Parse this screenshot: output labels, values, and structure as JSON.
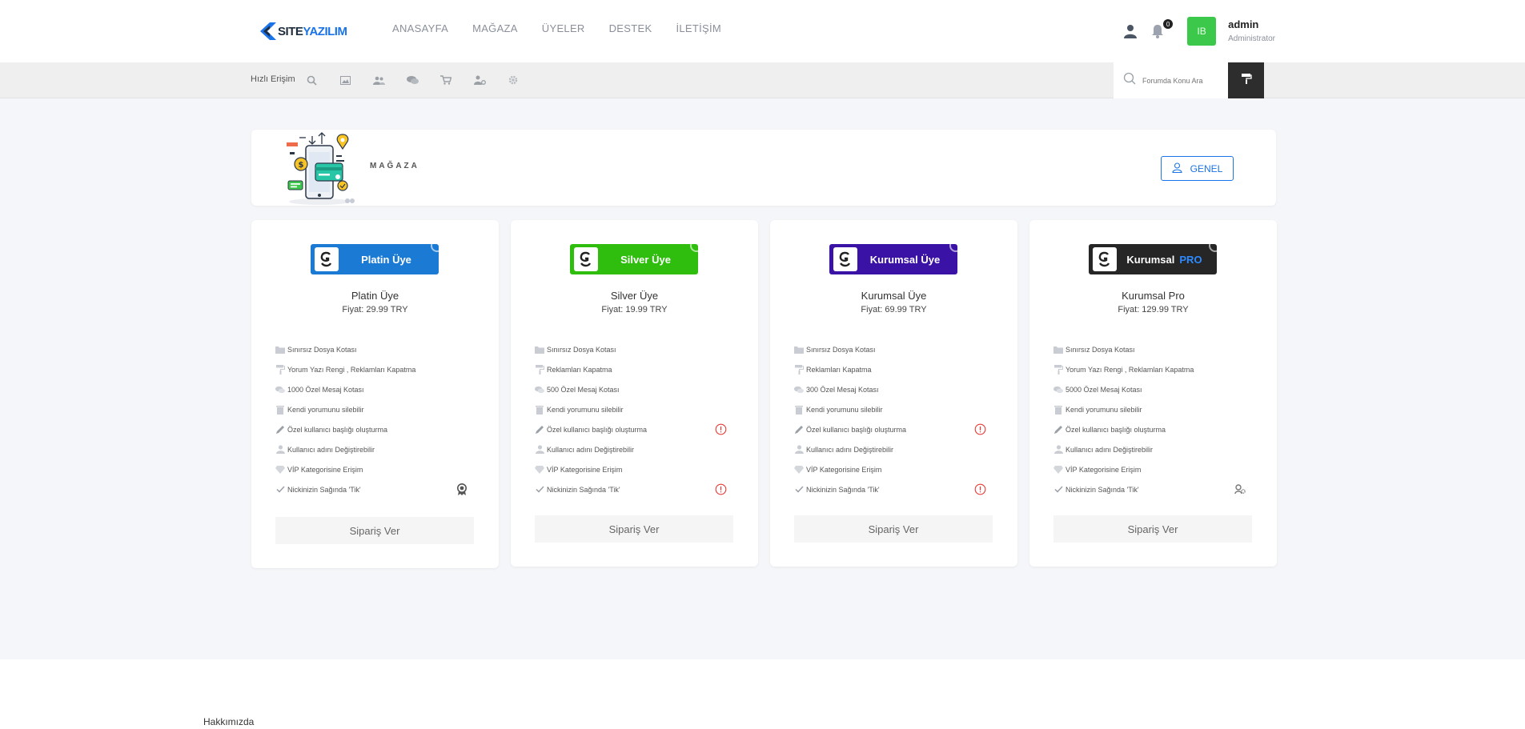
{
  "brand": {
    "part1": "SITE",
    "part2": "YAZILIM"
  },
  "nav": [
    "ANASAYFA",
    "MAĞAZA",
    "ÜYELER",
    "DESTEK",
    "İLETİŞİM"
  ],
  "header": {
    "notification_count": "0",
    "avatar_initials": "IB",
    "user_name": "admin",
    "user_role": "Administrator"
  },
  "quickbar": {
    "label": "Hızlı Erişim",
    "icons": [
      "search-icon",
      "image-icon",
      "users-icon",
      "chat-icon",
      "cart-icon",
      "user-settings-icon",
      "gear-icon"
    ],
    "search_placeholder": "Forumda Konu Ara"
  },
  "store": {
    "title": "MAĞAZA",
    "general_button": "GENEL"
  },
  "plans": [
    {
      "badge": "Platin Üye",
      "badge_color": "#1b7ad3",
      "name": "Platin Üye",
      "price": "Fiyat: 29.99 TRY",
      "features": [
        {
          "icon": "folder-icon",
          "text": "Sınırsız Dosya Kotası",
          "status": ""
        },
        {
          "icon": "paint-roller-icon",
          "text": "Yorum Yazı Rengi , Reklamları Kapatma",
          "status": ""
        },
        {
          "icon": "comments-icon",
          "text": "1000 Özel Mesaj Kotası",
          "status": ""
        },
        {
          "icon": "trash-icon",
          "text": "Kendi yorumunu silebilir",
          "status": ""
        },
        {
          "icon": "pencil-icon",
          "text": "Özel kullanıcı başlığı oluşturma",
          "status": ""
        },
        {
          "icon": "user-icon",
          "text": "Kullanıcı adını Değiştirebilir",
          "status": ""
        },
        {
          "icon": "diamond-icon",
          "text": "VİP Kategorisine Erişim",
          "status": ""
        },
        {
          "icon": "check-icon",
          "text": "Nickinizin Sağında 'Tik'",
          "status": "award"
        }
      ],
      "order": "Sipariş Ver"
    },
    {
      "badge": "Silver Üye",
      "badge_color": "#2fbe0e",
      "name": "Silver Üye",
      "price": "Fiyat: 19.99 TRY",
      "features": [
        {
          "icon": "folder-icon",
          "text": "Sınırsız Dosya Kotası",
          "status": ""
        },
        {
          "icon": "paint-roller-icon",
          "text": "Reklamları Kapatma",
          "status": ""
        },
        {
          "icon": "comments-icon",
          "text": "500 Özel Mesaj Kotası",
          "status": ""
        },
        {
          "icon": "trash-icon",
          "text": "Kendi yorumunu silebilir",
          "status": ""
        },
        {
          "icon": "pencil-icon",
          "text": "Özel kullanıcı başlığı oluşturma",
          "status": "unavailable"
        },
        {
          "icon": "user-icon",
          "text": "Kullanıcı adını Değiştirebilir",
          "status": ""
        },
        {
          "icon": "diamond-icon",
          "text": "VİP Kategorisine Erişim",
          "status": ""
        },
        {
          "icon": "check-icon",
          "text": "Nickinizin Sağında 'Tik'",
          "status": "unavailable"
        }
      ],
      "order": "Sipariş Ver"
    },
    {
      "badge": "Kurumsal Üye",
      "badge_color": "#3a12a6",
      "name": "Kurumsal Üye",
      "price": "Fiyat: 69.99 TRY",
      "features": [
        {
          "icon": "folder-icon",
          "text": "Sınırsız Dosya Kotası",
          "status": ""
        },
        {
          "icon": "paint-roller-icon",
          "text": "Reklamları Kapatma",
          "status": ""
        },
        {
          "icon": "comments-icon",
          "text": "300 Özel Mesaj Kotası",
          "status": ""
        },
        {
          "icon": "trash-icon",
          "text": "Kendi yorumunu silebilir",
          "status": ""
        },
        {
          "icon": "pencil-icon",
          "text": "Özel kullanıcı başlığı oluşturma",
          "status": "unavailable"
        },
        {
          "icon": "user-icon",
          "text": "Kullanıcı adını Değiştirebilir",
          "status": ""
        },
        {
          "icon": "diamond-icon",
          "text": "VİP Kategorisine Erişim",
          "status": ""
        },
        {
          "icon": "check-icon",
          "text": "Nickinizin Sağında 'Tik'",
          "status": "unavailable"
        }
      ],
      "order": "Sipariş Ver"
    },
    {
      "badge": "Kurumsal",
      "badge_suffix": "PRO",
      "badge_color": "#262626",
      "name": "Kurumsal Pro",
      "price": "Fiyat: 129.99 TRY",
      "features": [
        {
          "icon": "folder-icon",
          "text": "Sınırsız Dosya Kotası",
          "status": ""
        },
        {
          "icon": "paint-roller-icon",
          "text": "Yorum Yazı Rengi , Reklamları Kapatma",
          "status": ""
        },
        {
          "icon": "comments-icon",
          "text": "5000 Özel Mesaj Kotası",
          "status": ""
        },
        {
          "icon": "trash-icon",
          "text": "Kendi yorumunu silebilir",
          "status": ""
        },
        {
          "icon": "pencil-icon",
          "text": "Özel kullanıcı başlığı oluşturma",
          "status": ""
        },
        {
          "icon": "user-icon",
          "text": "Kullanıcı adını Değiştirebilir",
          "status": ""
        },
        {
          "icon": "diamond-icon",
          "text": "VİP Kategorisine Erişim",
          "status": ""
        },
        {
          "icon": "check-icon",
          "text": "Nickinizin Sağında 'Tik'",
          "status": "settings"
        }
      ],
      "order": "Sipariş Ver"
    }
  ],
  "footer": {
    "about": "Hakkımızda"
  }
}
